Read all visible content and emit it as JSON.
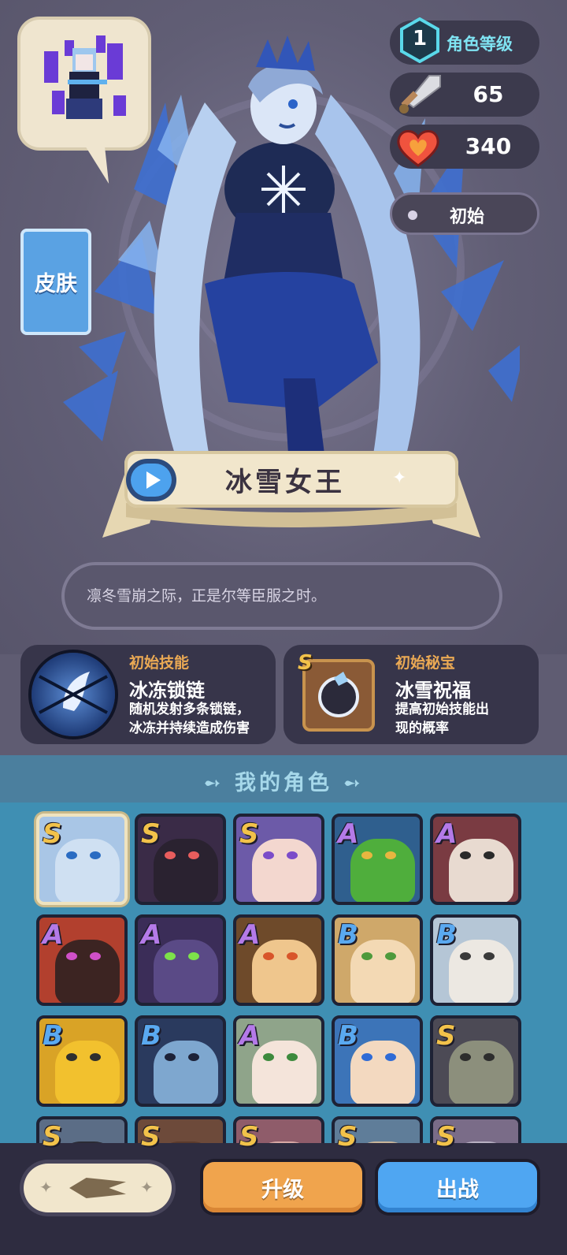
{
  "hero": {
    "level": "1",
    "level_label": "角色等级",
    "attack": "65",
    "hp": "340",
    "skin_state": "初始",
    "skin_tab_label": "皮肤",
    "name": "冰雪女王",
    "quote": "凛冬雪崩之际，正是尔等臣服之时。"
  },
  "skill": {
    "kicker": "初始技能",
    "title": "冰冻锁链",
    "desc_line1": "随机发射多条锁链，",
    "desc_line2": "冰冻并持续造成伤害"
  },
  "treasure": {
    "rank": "S",
    "kicker": "初始秘宝",
    "title": "冰雪祝福",
    "desc_line1": "提高初始技能出",
    "desc_line2": "现的概率"
  },
  "roster": {
    "title": "我的角色",
    "characters": [
      {
        "rank": "S",
        "bg": "#a9c6e6",
        "skin": "#cfe0f2",
        "eye": "#2a6cc2",
        "selected": true
      },
      {
        "rank": "S",
        "bg": "#3a2b47",
        "skin": "#2a2230",
        "eye": "#e85d5d",
        "selected": false
      },
      {
        "rank": "S",
        "bg": "#6c5aa8",
        "skin": "#f3d7cf",
        "eye": "#7b4cc9",
        "selected": false
      },
      {
        "rank": "A",
        "bg": "#2f5f8e",
        "skin": "#4fae3c",
        "eye": "#e8b640",
        "selected": false
      },
      {
        "rank": "A",
        "bg": "#7a3b42",
        "skin": "#e8dad0",
        "eye": "#2a2a2a",
        "selected": false
      },
      {
        "rank": "A",
        "bg": "#b2402e",
        "skin": "#3c2422",
        "eye": "#d050c8",
        "selected": false
      },
      {
        "rank": "A",
        "bg": "#3b2d58",
        "skin": "#5a4a86",
        "eye": "#7de24a",
        "selected": false
      },
      {
        "rank": "A",
        "bg": "#6e4a2a",
        "skin": "#efc68d",
        "eye": "#d8552a",
        "selected": false
      },
      {
        "rank": "B",
        "bg": "#cfa86a",
        "skin": "#f3d9b4",
        "eye": "#4e9a3c",
        "selected": false
      },
      {
        "rank": "B",
        "bg": "#b5c6d6",
        "skin": "#ece8e2",
        "eye": "#3a3a3a",
        "selected": false
      },
      {
        "rank": "B",
        "bg": "#d9a326",
        "skin": "#f2c12e",
        "eye": "#2f2f2f",
        "selected": false
      },
      {
        "rank": "B",
        "bg": "#2a3a5e",
        "skin": "#7ea7cf",
        "eye": "#1d2238",
        "selected": false
      },
      {
        "rank": "A",
        "bg": "#8fa48a",
        "skin": "#f4e4da",
        "eye": "#3d8a3d",
        "selected": false
      },
      {
        "rank": "B",
        "bg": "#3c74b8",
        "skin": "#f3d9c0",
        "eye": "#2f6bd6",
        "selected": false
      },
      {
        "rank": "S",
        "bg": "#4c4a55",
        "skin": "#8c8f7c",
        "eye": "#2d2d2d",
        "selected": false
      },
      {
        "rank": "S",
        "bg": "#5b6d86",
        "skin": "#2b2b35",
        "eye": "#333",
        "selected": false
      },
      {
        "rank": "S",
        "bg": "#6d4a3a",
        "skin": "#5a3a2c",
        "eye": "#333",
        "selected": false
      },
      {
        "rank": "S",
        "bg": "#8f5c6a",
        "skin": "#d8a9a5",
        "eye": "#333",
        "selected": false
      },
      {
        "rank": "S",
        "bg": "#5f7d99",
        "skin": "#c9b59a",
        "eye": "#333",
        "selected": false
      },
      {
        "rank": "S",
        "bg": "#7a6c88",
        "skin": "#b8b0c2",
        "eye": "#333",
        "selected": false
      }
    ]
  },
  "actions": {
    "upgrade": "升级",
    "battle": "出战"
  },
  "colors": {
    "rank_S": "#f2c24a",
    "rank_A": "#b47ae8",
    "rank_B": "#5aa9f0"
  }
}
